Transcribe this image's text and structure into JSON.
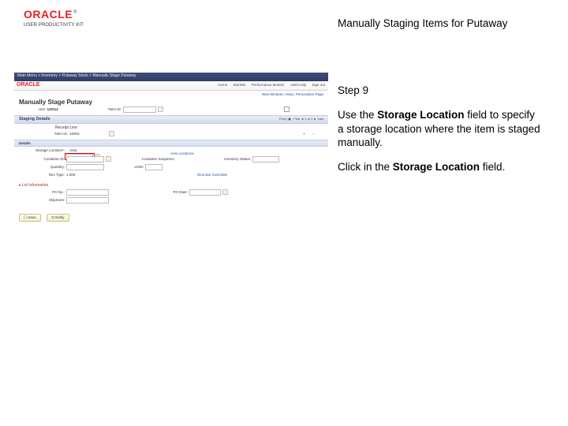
{
  "header": {
    "logo": "ORACLE",
    "logo_tm": "®",
    "subtext": "USER PRODUCTIVITY KIT",
    "title": "Manually Staging Items for Putaway"
  },
  "instructions": {
    "step": "Step 9",
    "para1_a": "Use the ",
    "para1_b": "Storage Location",
    "para1_c": " field to specify a storage location where the item is staged manually.",
    "para2_a": "Click in the ",
    "para2_b": "Storage Location",
    "para2_c": " field."
  },
  "ss": {
    "breadcrumb": "Main Menu > Inventory > Putaway Stock > Manually Stage Putaway",
    "menulinks": {
      "a": "Home",
      "b": "Worklist",
      "c": "Performance Monitor",
      "d": "Add to My",
      "e": "Sign out"
    },
    "viewpage_a": "New Window",
    "viewpage_b": "Help",
    "viewpage_c": "Personalize Page",
    "page_title": "Manually Stage Putaway",
    "unit_lbl": "Unit:",
    "unit_val": "US012",
    "itemid_lbl": "*Item ID:",
    "receiptline_lbl": "Receipt Line",
    "itemval": "10003",
    "storloc_lbl": "Storage Location*:",
    "area_lbl": "Area",
    "autoloc": "Auto Locations",
    "container_lbl": "Container ID:",
    "contseq_lbl": "Container Sequence:",
    "invstatus_lbl": "Inventory Status:",
    "quantity_lbl": "Quantity:",
    "uom_lbl": "UOM:",
    "rectype_lbl": "Rec Type:",
    "recline_val": "1.000",
    "directed_title": "Directive Overrides",
    "pono_lbl": "PO No.:",
    "podate_lbl": "PO Date:",
    "shipment_lbl": "Shipment:",
    "lotinfo": "Lot Information",
    "btn_save": "Save",
    "btn_notify": "Notify",
    "bar_staging": "Staging Details",
    "bar_details": "Details",
    "finddot": "Find",
    "first": "First",
    "of": "of 1",
    "last": "Last"
  }
}
